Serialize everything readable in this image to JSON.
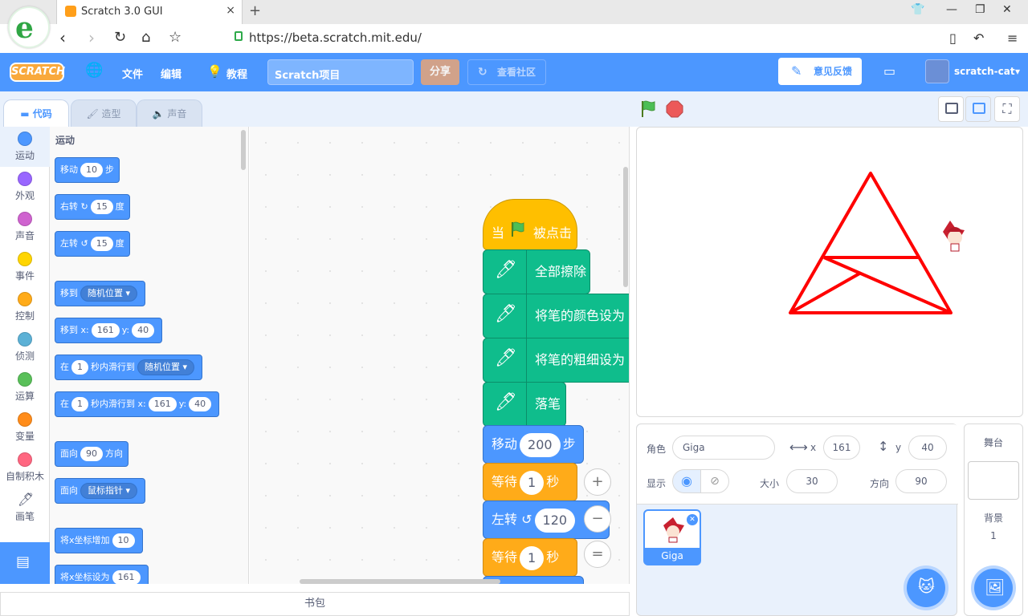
{
  "browser": {
    "tab_title": "Scratch 3.0 GUI",
    "tab_close": "×",
    "new_tab": "+",
    "url": "https://beta.scratch.mit.edu/"
  },
  "menubar": {
    "logo": "SCRATCH",
    "file": "文件",
    "edit": "编辑",
    "tutorials": "教程",
    "project_title": "Scratch项目",
    "share": "分享",
    "see_community": "查看社区",
    "feedback": "意见反馈",
    "username": "scratch-cat"
  },
  "tabs": {
    "code": "代码",
    "costumes": "造型",
    "sounds": "声音"
  },
  "categories": [
    {
      "label": "运动",
      "color": "#4c97ff"
    },
    {
      "label": "外观",
      "color": "#9966ff"
    },
    {
      "label": "声音",
      "color": "#cf63cf"
    },
    {
      "label": "事件",
      "color": "#ffd500"
    },
    {
      "label": "控制",
      "color": "#ffab19"
    },
    {
      "label": "侦测",
      "color": "#5cb1d6"
    },
    {
      "label": "运算",
      "color": "#59c059"
    },
    {
      "label": "变量",
      "color": "#ff8c1a"
    },
    {
      "label": "自制积木",
      "color": "#ff6680"
    },
    {
      "label": "画笔",
      "color": "#0fbd8c"
    }
  ],
  "palette": {
    "heading": "运动",
    "move": {
      "a": "移动",
      "v": "10",
      "b": "步"
    },
    "turn_right": {
      "a": "右转",
      "v": "15",
      "b": "度"
    },
    "turn_left": {
      "a": "左转",
      "v": "15",
      "b": "度"
    },
    "goto": {
      "a": "移到",
      "dd": "随机位置"
    },
    "goto_xy": {
      "a": "移到 x:",
      "x": "161",
      "b": "y:",
      "y": "40"
    },
    "glide": {
      "a": "在",
      "v": "1",
      "b": "秒内滑行到",
      "dd": "随机位置"
    },
    "glide_xy": {
      "a": "在",
      "v": "1",
      "b": "秒内滑行到 x:",
      "x": "161",
      "c": "y:",
      "y": "40"
    },
    "point_dir": {
      "a": "面向",
      "v": "90",
      "b": "方向"
    },
    "point_towards": {
      "a": "面向",
      "dd": "鼠标指针"
    },
    "change_x": {
      "a": "将x坐标增加",
      "v": "10"
    },
    "set_x": {
      "a": "将x坐标设为",
      "v": "161"
    }
  },
  "script": {
    "hat_a": "当",
    "hat_b": "被点击",
    "clear": "全部擦除",
    "set_color": "将笔的颜色设为",
    "set_size": "将笔的粗细设为",
    "pen_down": "落笔",
    "move": {
      "a": "移动",
      "v": "200",
      "b": "步"
    },
    "wait1": {
      "a": "等待",
      "v": "1",
      "b": "秒"
    },
    "turn": {
      "a": "左转",
      "v": "120"
    },
    "wait2": {
      "a": "等待",
      "v": "1",
      "b": "秒"
    }
  },
  "zoom": {
    "in": "+",
    "out": "−",
    "reset": "="
  },
  "backpack": "书包",
  "sprite_info": {
    "sprite_label": "角色",
    "sprite_name": "Giga",
    "x_label": "x",
    "x": "161",
    "y_label": "y",
    "y": "40",
    "show_label": "显示",
    "size_label": "大小",
    "size": "30",
    "direction_label": "方向",
    "direction": "90"
  },
  "sprite_tile_name": "Giga",
  "stage_pane": {
    "title": "舞台",
    "backdrops_label": "背景",
    "backdrops_count": "1"
  },
  "colors": {
    "accent": "#4c97ff",
    "pen": "#0fbd8c",
    "control": "#ffab19",
    "event": "#ffbf00",
    "drawing": "#ff0000"
  }
}
